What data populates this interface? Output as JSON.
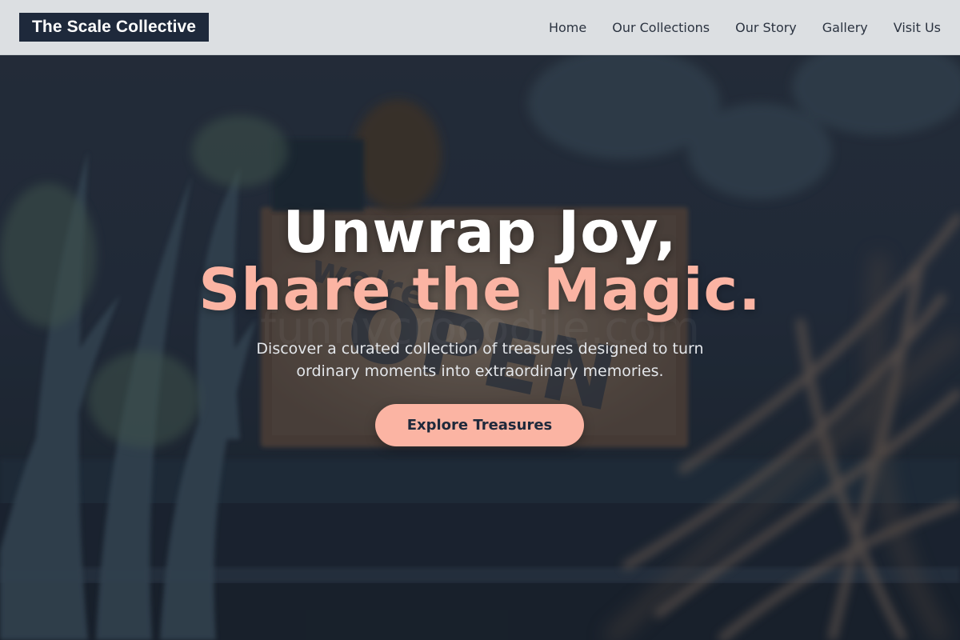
{
  "header": {
    "logo": "The Scale Collective",
    "nav": [
      {
        "label": "Home"
      },
      {
        "label": "Our Collections"
      },
      {
        "label": "Our Story"
      },
      {
        "label": "Gallery"
      },
      {
        "label": "Visit Us"
      }
    ]
  },
  "hero": {
    "headline_line1": "Unwrap Joy,",
    "headline_line2": "Share the Magic.",
    "subtext": "Discover a curated collection of treasures designed to turn ordinary moments into extraordinary memories.",
    "cta_label": "Explore Treasures",
    "background": "shop-window-open-sign-plants-photo"
  },
  "colors": {
    "header_bg": "#dcdfe2",
    "logo_bg": "#1e293b",
    "accent": "#fbb4a3",
    "hero_text": "#ffffff"
  }
}
